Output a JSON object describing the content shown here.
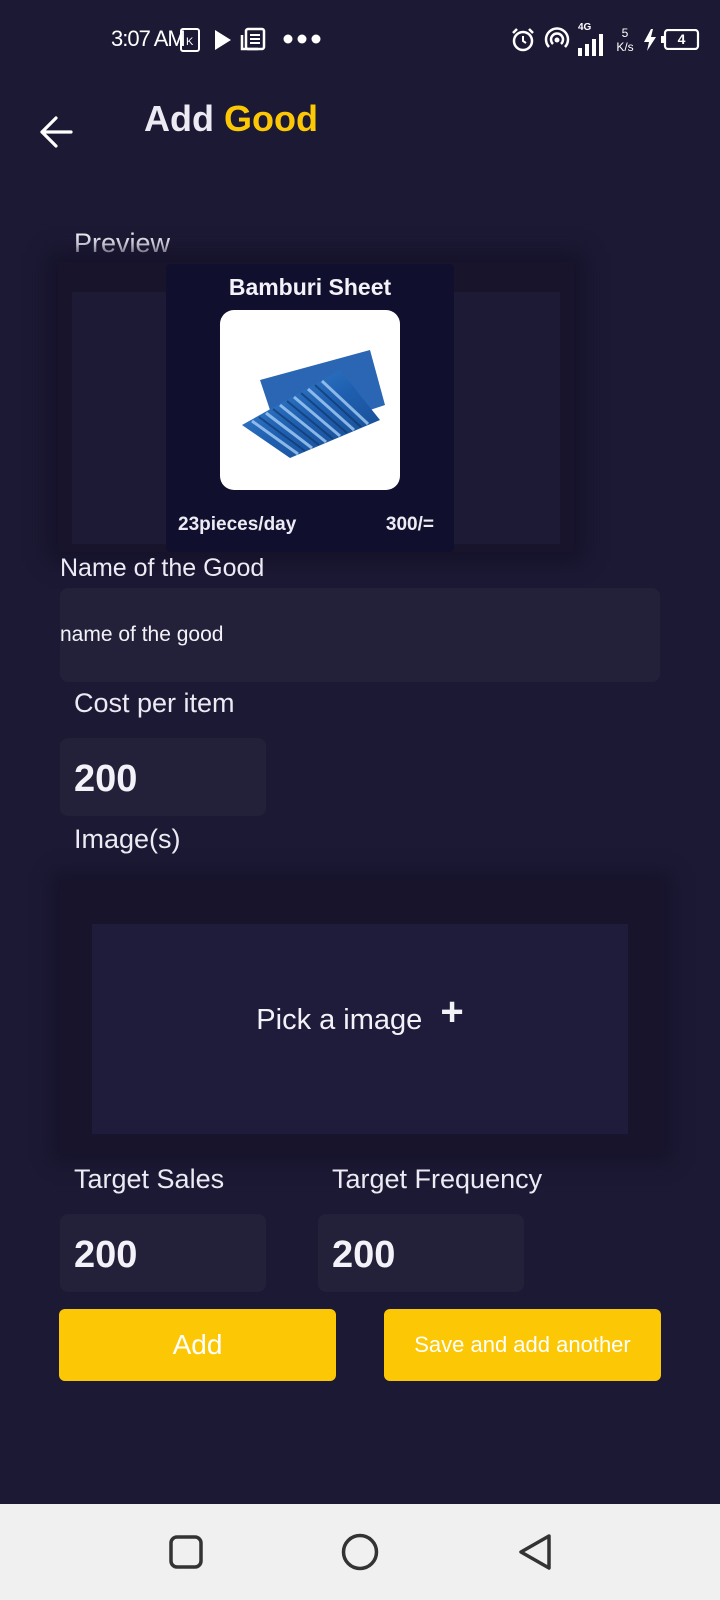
{
  "status_bar": {
    "time": "3:07 AM",
    "network": "4G",
    "speed_value": "5",
    "speed_unit": "K/s",
    "battery": "4"
  },
  "header": {
    "title_part1": "Add",
    "title_part2": "Good"
  },
  "preview": {
    "label": "Preview",
    "card_title": "Bamburi Sheet",
    "rate": "23pieces/day",
    "price": "300/="
  },
  "name_field": {
    "label": "Name of the Good",
    "value": "name of the good"
  },
  "cost_field": {
    "label": "Cost per item",
    "value": "200"
  },
  "images": {
    "label": "Image(s)",
    "pick_text": "Pick a image",
    "plus": "+"
  },
  "target_sales": {
    "label": "Target Sales",
    "value": "200"
  },
  "target_frequency": {
    "label": "Target Frequency",
    "value": "200"
  },
  "buttons": {
    "add": "Add",
    "save_another": "Save and add another"
  },
  "colors": {
    "background": "#1c1934",
    "accent": "#fcc805",
    "card": "#110f2e",
    "navbar": "#f0f0f0"
  }
}
